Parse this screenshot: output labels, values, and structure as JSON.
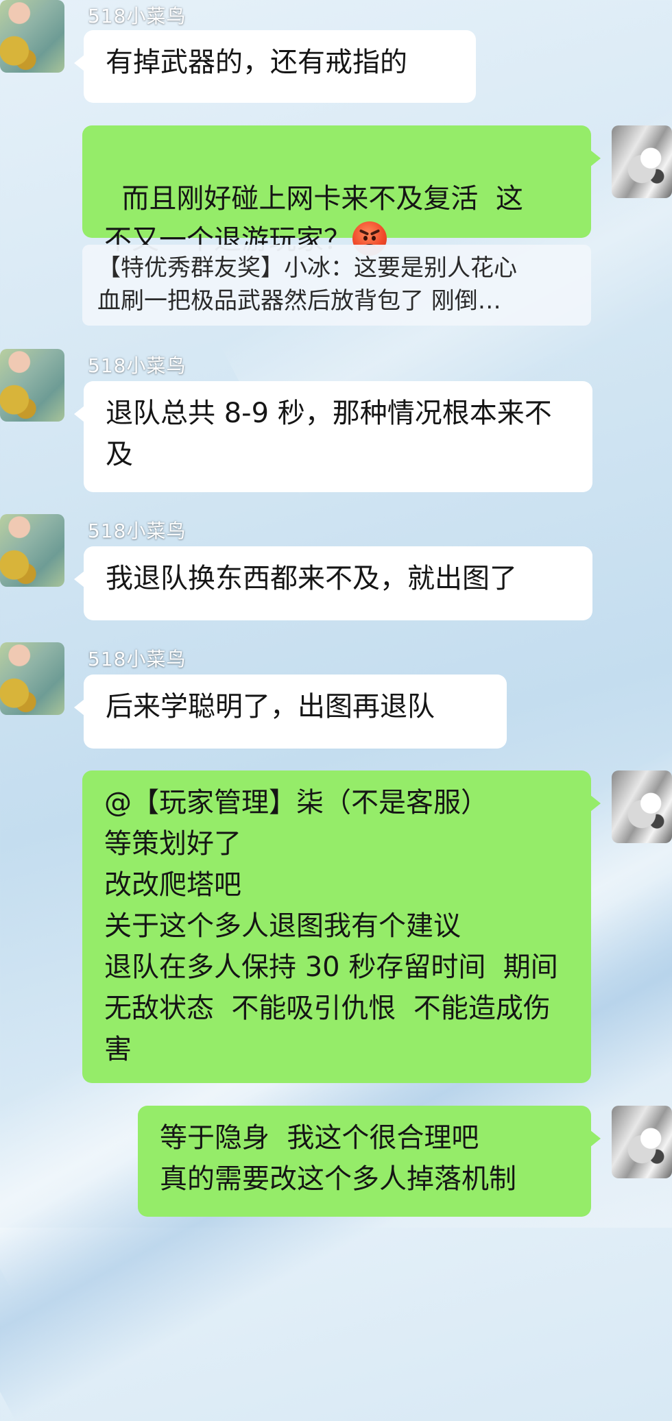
{
  "messages": [
    {
      "sender": "518小菜鸟",
      "text": "有掉武器的，还有戒指的"
    },
    {
      "text_line1": "而且刚好碰上网卡来不及复活  这",
      "text_line2": "不又一个退游玩家？",
      "emoji": "angry-face-emoji"
    },
    {
      "quote_line1": "【特优秀群友奖】小冰：这要是别人花心",
      "quote_line2": "血刷一把极品武器然后放背包了  刚倒…"
    },
    {
      "sender": "518小菜鸟",
      "text": "退队总共 8-9 秒，那种情况根本来不及"
    },
    {
      "sender": "518小菜鸟",
      "text": "我退队换东西都来不及，就出图了"
    },
    {
      "sender": "518小菜鸟",
      "text": "后来学聪明了，出图再退队"
    },
    {
      "text": "@【玩家管理】柒（不是客服）\n等策划好了\n改改爬塔吧\n关于这个多人退图我有个建议\n退队在多人保持 30 秒存留时间  期间无敌状态  不能吸引仇恨  不能造成伤害"
    },
    {
      "text": "等于隐身  我这个很合理吧\n真的需要改这个多人掉落机制"
    }
  ]
}
